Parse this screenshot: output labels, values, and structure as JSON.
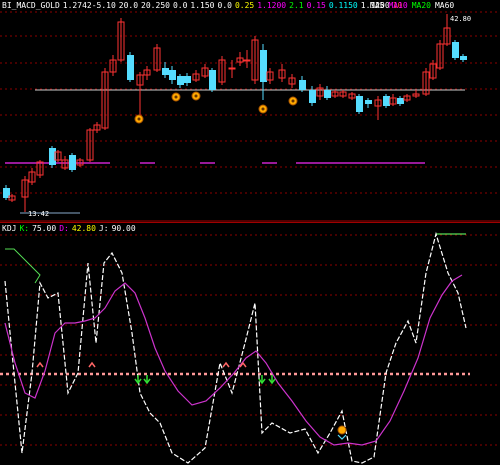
{
  "top_header": {
    "title": "BI_MACD_GOLD",
    "items": [
      {
        "text": "1.2742-5.10",
        "color": "#ffffff"
      },
      {
        "text": "20.0",
        "color": "#ffffff"
      },
      {
        "text": "20.250",
        "color": "#ffffff"
      },
      {
        "text": "0.0",
        "color": "#ffffff"
      },
      {
        "text": "1.150",
        "color": "#ffffff"
      },
      {
        "text": "0.0",
        "color": "#ffffff"
      },
      {
        "text": "0.25",
        "color": "#ffff00"
      },
      {
        "text": "1.1200",
        "color": "#ff00ff"
      },
      {
        "text": "2.1",
        "color": "#00ff00"
      },
      {
        "text": "0.15",
        "color": "#ff00ff"
      },
      {
        "text": "0.1150",
        "color": "#00ffff"
      },
      {
        "text": "1.1200",
        "color": "#ffffff"
      },
      {
        "text": "10",
        "color": "#ff4040"
      }
    ],
    "right_items": [
      {
        "text": "MA5",
        "color": "#ffffff"
      },
      {
        "text": "MA10",
        "color": "#ff00ff"
      },
      {
        "text": "MA20",
        "color": "#00ff00"
      },
      {
        "text": "MA60",
        "color": "#ffffff"
      }
    ]
  },
  "bottom_header": {
    "title": "KDJ",
    "items": [
      {
        "text": "K:",
        "color": "#00ff00"
      },
      {
        "text": "75.00",
        "color": "#ffffff"
      },
      {
        "text": "D:",
        "color": "#ff00ff"
      },
      {
        "text": "42.80",
        "color": "#ffff00"
      },
      {
        "text": "J:",
        "color": "#ffffff"
      },
      {
        "text": "90.00",
        "color": "#ffffff"
      }
    ]
  },
  "top_labels": {
    "high_price": "42.80",
    "low_price": "13.42"
  },
  "colors": {
    "background": "#000000",
    "grid": "#8b0000",
    "up_candle": "#ff3333",
    "down_candle": "#55ddff",
    "baseline": "#cccccc",
    "level_line": "#cc22cc",
    "k_line": "#ffffff",
    "d_line": "#cc33cc",
    "j_line": "#55dd55",
    "mid_dotted": "#ff9999",
    "signal_up": "#ff6666",
    "signal_down": "#33dd33",
    "coin": "#ffaa00"
  }
}
